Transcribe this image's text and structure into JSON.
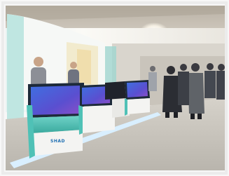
{
  "photo": {
    "kiosk_brand": "SHAD",
    "colors": {
      "ceiling": "#c9c2b6",
      "wall_white": "#f4f2ee",
      "floor": "#dcd8d0",
      "kiosk_teal": "#4fc1b6",
      "kiosk_white": "#f2f2f0",
      "screen_blue": "#4a5fd0",
      "screen_purple": "#7a4fc8",
      "floor_light_strip": "#cfe9ff",
      "visitor_dark": "#2b2d33"
    }
  }
}
